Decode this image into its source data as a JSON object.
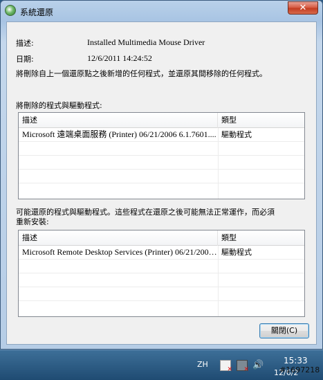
{
  "window": {
    "title": "系統還原",
    "close_glyph": "✕"
  },
  "info": {
    "description_label": "描述:",
    "description_value": "Installed Multimedia Mouse Driver",
    "date_label": "日期:",
    "date_value": "12/6/2011 14:24:52",
    "notice": "將刪除自上一個還原點之後新增的任何程式，並還原其間移除的任何程式。"
  },
  "deleted_section": {
    "label": "將刪除的程式與驅動程式:",
    "columns": [
      "描述",
      "類型"
    ],
    "rows": [
      [
        "Microsoft 遠端桌面服務 (Printer) 06/21/2006 6.1.7601....",
        "驅動程式"
      ]
    ]
  },
  "restored_section": {
    "label_line1": "可能還原的程式與驅動程式。這些程式在還原之後可能無法正常運作，而必須",
    "label_line2": "重新安裝:",
    "columns": [
      "描述",
      "類型"
    ],
    "rows": [
      [
        "Microsoft Remote Desktop Services (Printer) 06/21/2006 ...",
        "驅動程式"
      ]
    ]
  },
  "buttons": {
    "close_label": "關閉(C)"
  },
  "taskbar": {
    "language": "ZH",
    "time": "15:33",
    "date_partial": "12/6/2",
    "volume_glyph": "🔊"
  },
  "watermark": "#1697218"
}
